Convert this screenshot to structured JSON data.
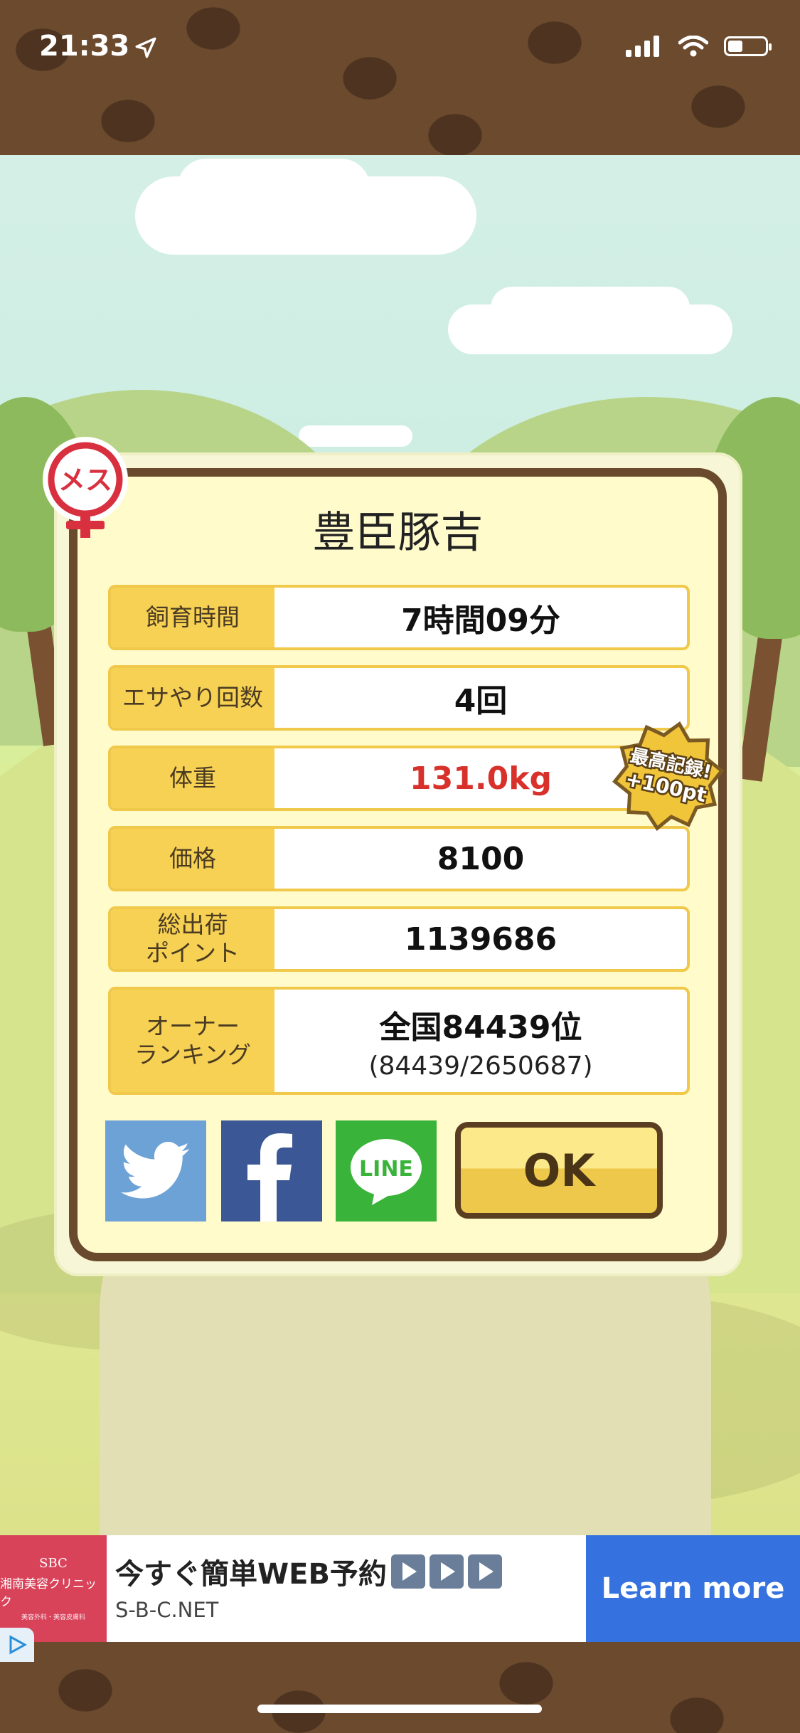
{
  "status_bar": {
    "time": "21:33"
  },
  "dialog": {
    "pig_name": "豊臣豚吉",
    "gender_badge": "メス",
    "record_badge": {
      "line1": "最高記録!",
      "line2": "+100pt"
    },
    "rows": [
      {
        "label": "飼育時間",
        "value": "7時間09分"
      },
      {
        "label": "エサやり回数",
        "value": "4回"
      },
      {
        "label": "体重",
        "value": "131.0kg"
      },
      {
        "label": "価格",
        "value": "8100"
      },
      {
        "label": "総出荷\nポイント",
        "value": "1139686"
      },
      {
        "label": "オーナー\nランキング",
        "value": "全国84439位",
        "sub": "(84439/2650687)"
      }
    ],
    "share": {
      "line_label": "LINE"
    },
    "ok_label": "OK"
  },
  "ad": {
    "logo_line1": "SBC",
    "logo_line2": "湘南美容クリニック",
    "logo_line3": "美容外科・美容皮膚科",
    "title": "今すぐ簡単WEB予約",
    "url": "S-B-C.NET",
    "cta": "Learn more"
  },
  "colors": {
    "value_highlight": "#d8302a",
    "label_bg": "#f7d154",
    "ad_cta": "#3572e0"
  }
}
